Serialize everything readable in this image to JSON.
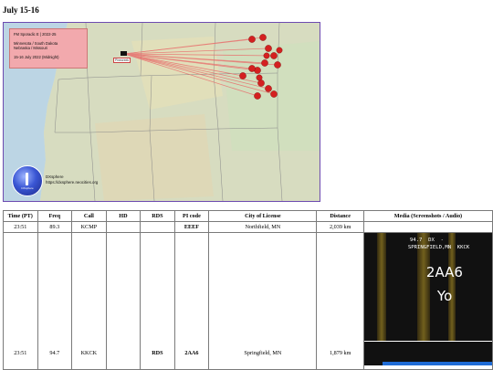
{
  "page": {
    "heading": "July 15-16"
  },
  "map": {
    "legend": {
      "line1": "FM Sporadic E | 2022-25",
      "line2": "Minnesota / South Dakota",
      "line3": "Nebraska / Missouri",
      "line4": "15-16 July 2022 (Midnight)"
    },
    "receiver_label": "Pinecreek",
    "branding": {
      "name": "DXsphere",
      "url": "https://dxsphere.neocities.org",
      "logo_text": "DXsphere"
    },
    "colors": {
      "legend_bg": "#f2a9ad",
      "markers": "#d42020",
      "paths": "#e8706e",
      "border": "#6d4bb0"
    }
  },
  "table": {
    "headers": [
      "Time (PT)",
      "Freq",
      "Call",
      "HD",
      "RDS",
      "PI code",
      "City of License",
      "Distance",
      "Media (Screenshots / Audio)"
    ],
    "rows": [
      {
        "time": "23:51",
        "freq": "89.3",
        "call": "KCMP",
        "hd": "",
        "rds": "",
        "pi": "EEEF",
        "city": "Northfield, MN",
        "distance": "2,039 km"
      },
      {
        "time": "23:51",
        "freq": "94.7",
        "call": "KKCK",
        "hd": "",
        "rds": "RDS",
        "pi": "2AA6",
        "city": "Springfield, MN",
        "distance": "1,879 km"
      }
    ],
    "screenshot": {
      "line1": "94.7  DX  -",
      "line2": "SPRINGFIELD,MN  KKCK",
      "pi": "2AA6",
      "text": "Yo"
    }
  }
}
